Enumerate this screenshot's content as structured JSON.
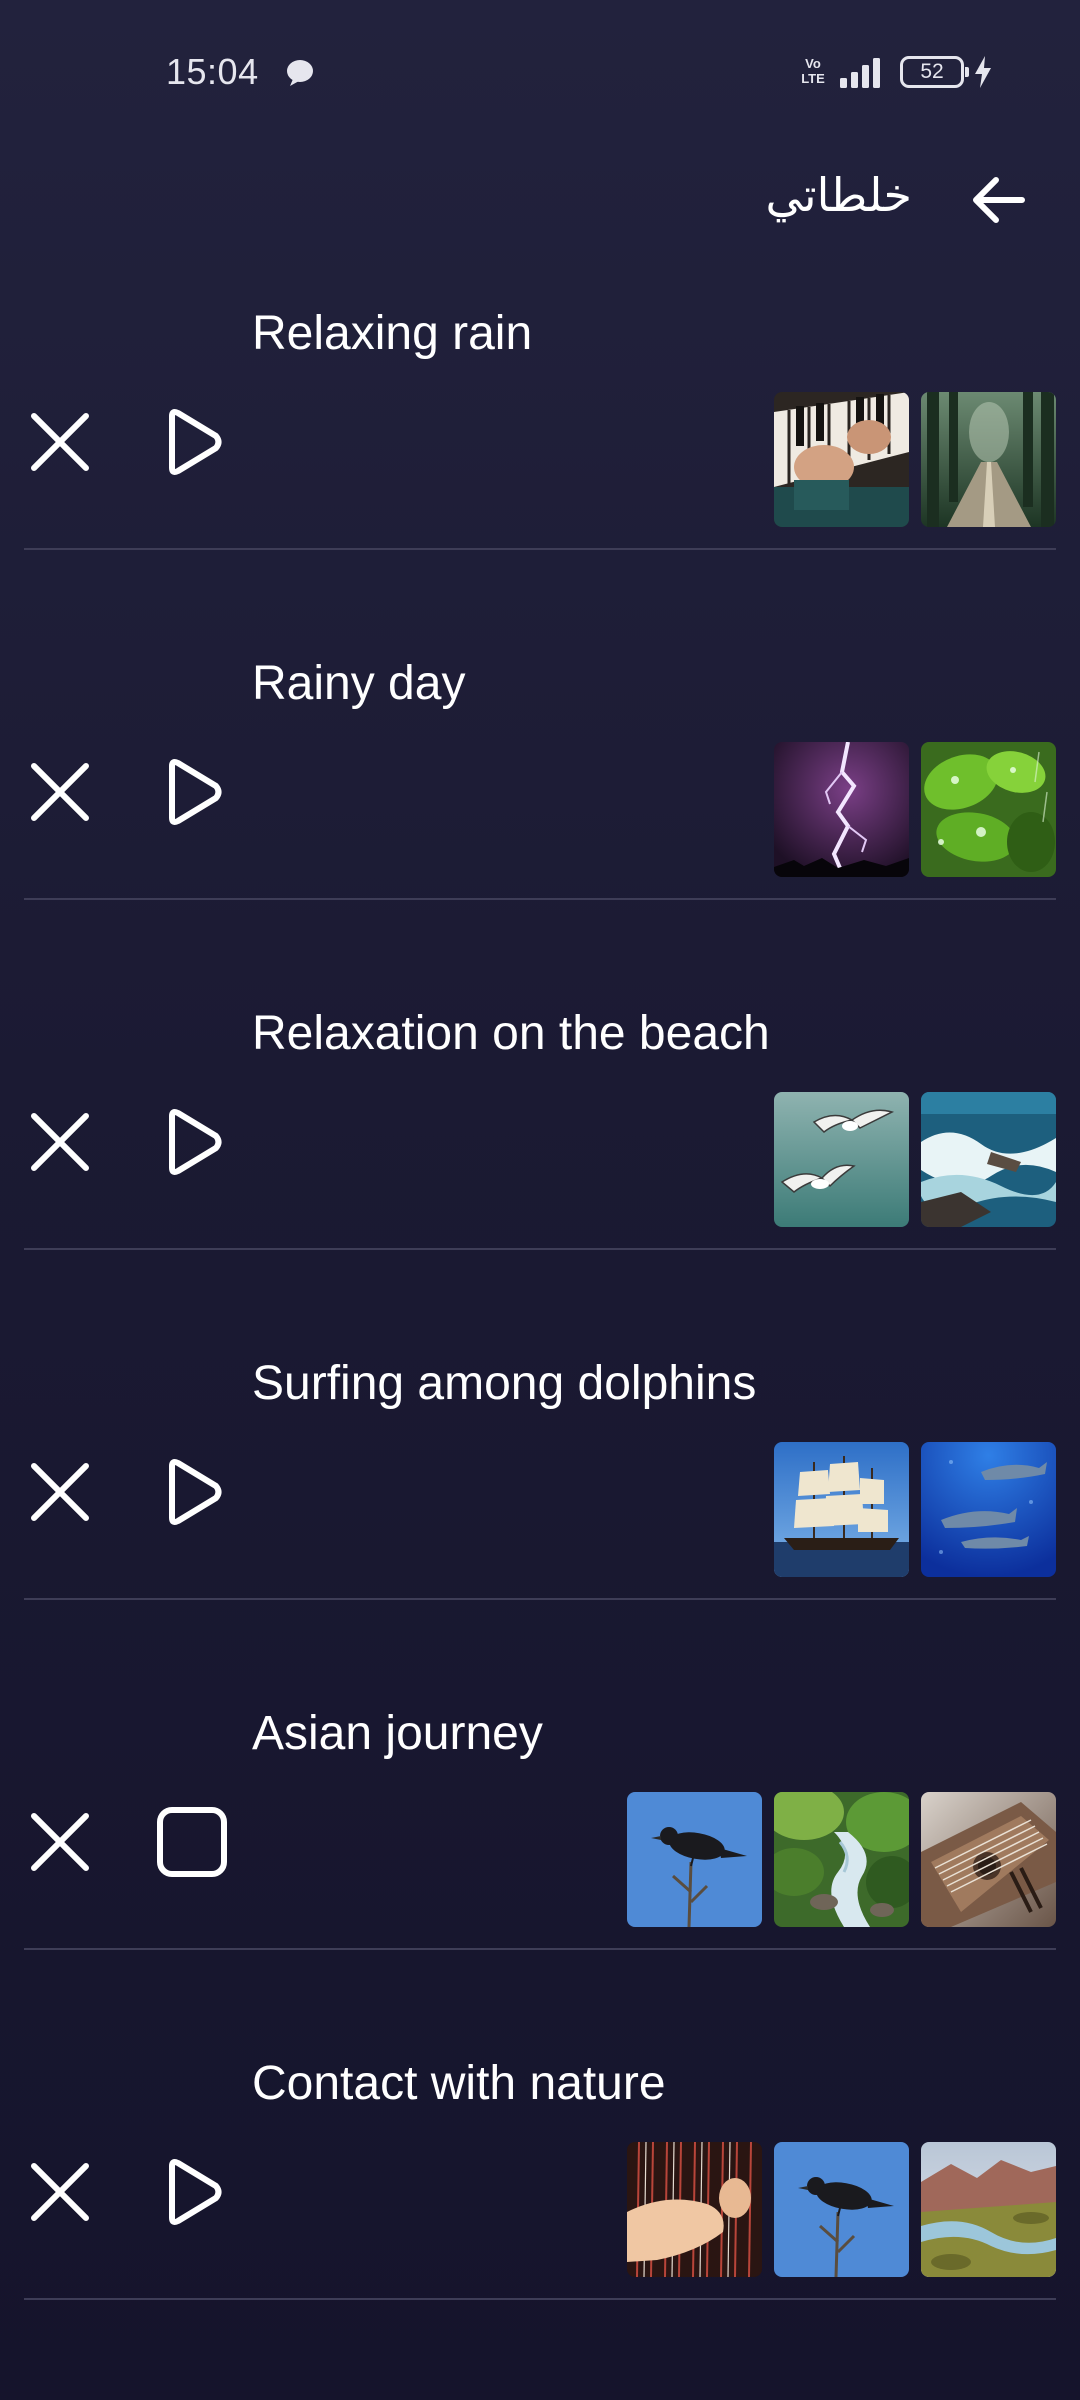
{
  "status_bar": {
    "time": "15:04",
    "network_label": "Vo\nLTE",
    "battery_level": "52",
    "icons": [
      "message-bubble-icon",
      "volte-icon",
      "signal-icon",
      "battery-icon",
      "charging-icon"
    ]
  },
  "header": {
    "title": "خلطاتي",
    "back_icon": "arrow-left-icon"
  },
  "colors": {
    "background_top": "#22223d",
    "background_bottom": "#15142c",
    "divider": "#3e3d57",
    "text": "#ffffff"
  },
  "mixes": [
    {
      "title": "Relaxing rain",
      "state": "paused",
      "control_icon": "play-icon",
      "sounds": [
        "piano-image",
        "forest-road-image"
      ]
    },
    {
      "title": "Rainy day",
      "state": "paused",
      "control_icon": "play-icon",
      "sounds": [
        "lightning-image",
        "rain-leaves-image"
      ]
    },
    {
      "title": "Relaxation on the beach",
      "state": "paused",
      "control_icon": "play-icon",
      "sounds": [
        "seagulls-image",
        "ocean-waves-image"
      ]
    },
    {
      "title": "Surfing among dolphins",
      "state": "paused",
      "control_icon": "play-icon",
      "sounds": [
        "sailing-ship-image",
        "dolphins-image"
      ]
    },
    {
      "title": "Asian journey",
      "state": "playing",
      "control_icon": "stop-icon",
      "sounds": [
        "bird-image",
        "mountain-stream-image",
        "zither-image"
      ]
    },
    {
      "title": "Contact with nature",
      "state": "paused",
      "control_icon": "play-icon",
      "sounds": [
        "harp-image",
        "bird-image",
        "river-valley-image"
      ]
    }
  ]
}
